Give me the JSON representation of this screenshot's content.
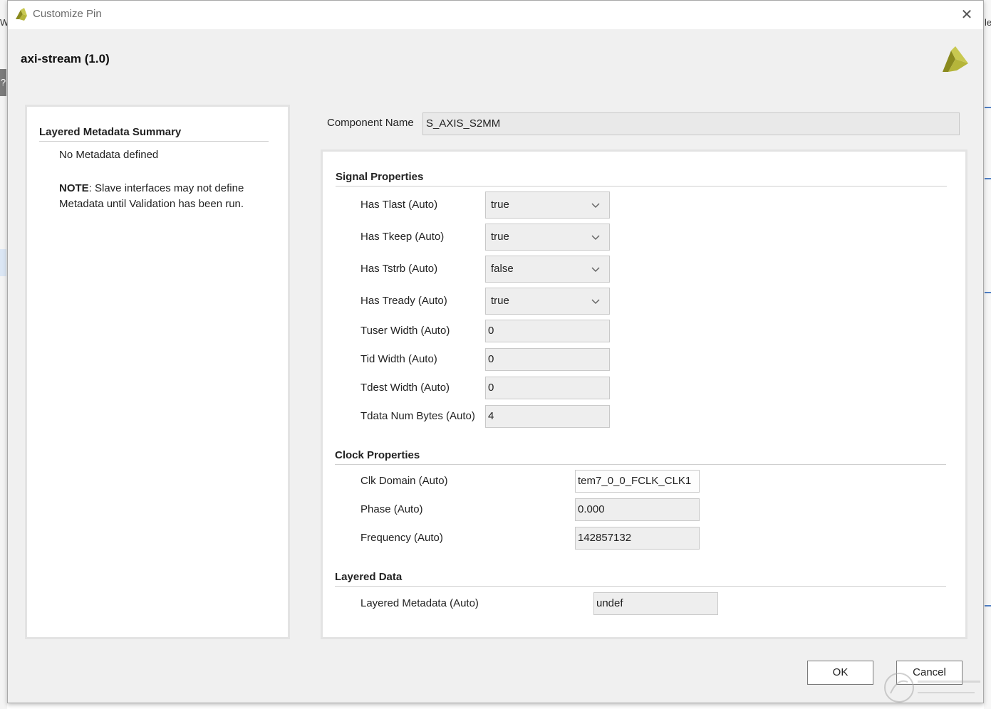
{
  "background": {
    "left_text": "Wi",
    "right_text": "le"
  },
  "window": {
    "title": "Customize Pin",
    "close_symbol": "✕"
  },
  "ip": {
    "title": "axi-stream (1.0)"
  },
  "summary": {
    "heading": "Layered Metadata Summary",
    "text": "No Metadata defined",
    "note_bold": "NOTE",
    "note_text": ": Slave interfaces may not define Metadata until Validation has been run."
  },
  "component": {
    "label": "Component Name",
    "value": "S_AXIS_S2MM"
  },
  "signal": {
    "title": "Signal Properties",
    "has_tlast": {
      "label": "Has Tlast (Auto)",
      "value": "true"
    },
    "has_tkeep": {
      "label": "Has Tkeep (Auto)",
      "value": "true"
    },
    "has_tstrb": {
      "label": "Has Tstrb (Auto)",
      "value": "false"
    },
    "has_tready": {
      "label": "Has Tready (Auto)",
      "value": "true"
    },
    "tuser_width": {
      "label": "Tuser Width (Auto)",
      "value": "0"
    },
    "tid_width": {
      "label": "Tid Width (Auto)",
      "value": "0"
    },
    "tdest_width": {
      "label": "Tdest Width (Auto)",
      "value": "0"
    },
    "tdata_num_bytes": {
      "label": "Tdata Num Bytes (Auto)",
      "value": "4"
    }
  },
  "clock": {
    "title": "Clock Properties",
    "clk_domain": {
      "label": "Clk Domain (Auto)",
      "value": "tem7_0_0_FCLK_CLK1"
    },
    "phase": {
      "label": "Phase (Auto)",
      "value": "0.000"
    },
    "frequency": {
      "label": "Frequency (Auto)",
      "value": "142857132"
    }
  },
  "layered": {
    "title": "Layered Data",
    "metadata": {
      "label": "Layered Metadata (Auto)",
      "value": "undef"
    }
  },
  "buttons": {
    "ok": "OK",
    "cancel": "Cancel"
  },
  "colors": {
    "logo_dark": "#8a8a1e",
    "logo_light": "#c8c850",
    "accent": "#4f7fc4"
  }
}
